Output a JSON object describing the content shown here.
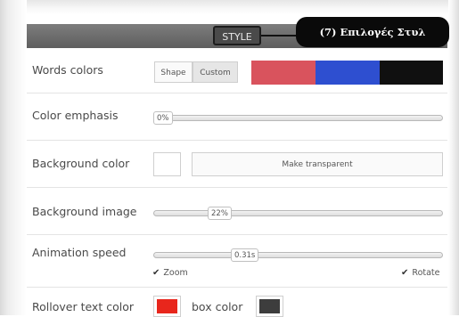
{
  "header": {
    "tab_label": "STYLE",
    "callout_text": "(7) Επιλογές Στυλ"
  },
  "rows": {
    "words_colors": {
      "label": "Words colors",
      "mode_buttons": [
        "Shape",
        "Custom"
      ],
      "active_mode": "Custom",
      "palette": [
        "#d9535d",
        "#2e4fd0",
        "#101010"
      ]
    },
    "color_emphasis": {
      "label": "Color emphasis",
      "value_text": "0%",
      "value": 0
    },
    "background_color": {
      "label": "Background color",
      "swatch": "#ffffff",
      "button_label": "Make transparent"
    },
    "background_image": {
      "label": "Background image",
      "value_text": "22%",
      "value": 22
    },
    "animation_speed": {
      "label": "Animation speed",
      "value_text": "0.31s",
      "checkboxes": [
        {
          "label": "Zoom",
          "checked": true
        },
        {
          "label": "Rotate",
          "checked": true
        }
      ]
    },
    "rollover": {
      "label": "Rollover text color",
      "text_color": "#e8261c",
      "box_label": "box color",
      "box_color": "#3d3d3d"
    }
  }
}
